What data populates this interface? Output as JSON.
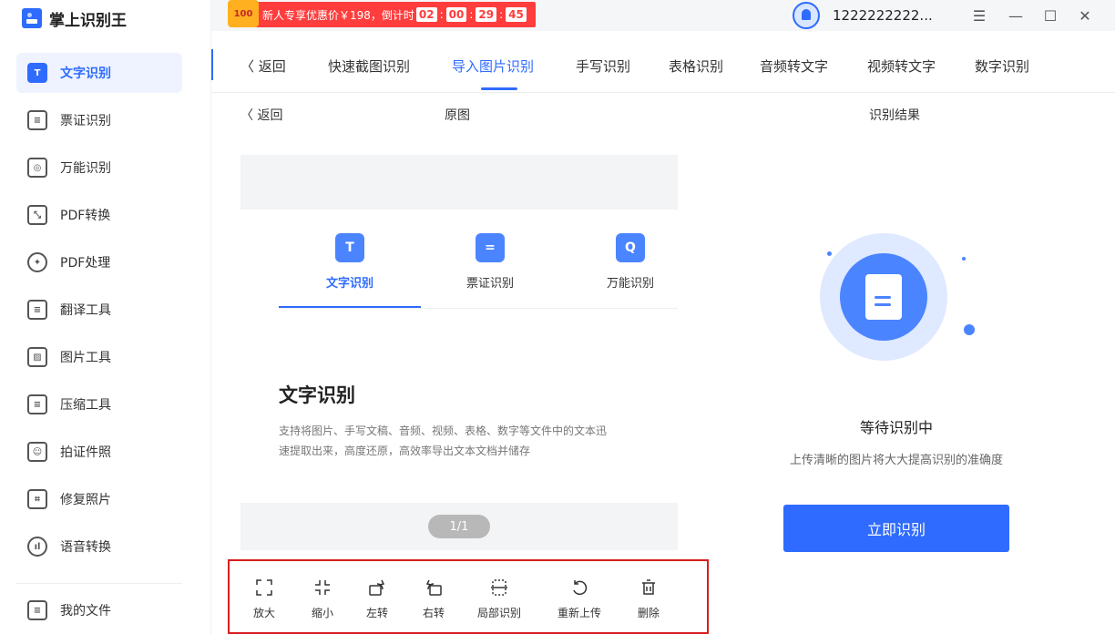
{
  "app": {
    "title": "掌上识别王"
  },
  "promo": {
    "badge": "100",
    "text": "新人专享优惠价￥198，倒计时",
    "h": "02",
    "m": "00",
    "s": "29",
    "ms": "45",
    "sep": ":"
  },
  "user": {
    "name": "1222222222..."
  },
  "window": {
    "menu": "☰",
    "minimize": "—",
    "maximize": "☐",
    "close": "✕"
  },
  "sidebar": {
    "items": [
      {
        "label": "文字识别",
        "icon": "text-recognition-icon",
        "glyph": "T"
      },
      {
        "label": "票证识别",
        "icon": "ticket-icon",
        "glyph": "≡"
      },
      {
        "label": "万能识别",
        "icon": "universal-scan-icon",
        "glyph": "◎"
      },
      {
        "label": "PDF转换",
        "icon": "pdf-convert-icon",
        "glyph": "⤡"
      },
      {
        "label": "PDF处理",
        "icon": "pdf-process-icon",
        "glyph": "✦"
      },
      {
        "label": "翻译工具",
        "icon": "translate-icon",
        "glyph": "≡"
      },
      {
        "label": "图片工具",
        "icon": "image-tool-icon",
        "glyph": "▨"
      },
      {
        "label": "压缩工具",
        "icon": "compress-icon",
        "glyph": "≡"
      },
      {
        "label": "拍证件照",
        "icon": "id-photo-icon",
        "glyph": "☺"
      },
      {
        "label": "修复照片",
        "icon": "repair-photo-icon",
        "glyph": "⌗"
      },
      {
        "label": "语音转换",
        "icon": "voice-convert-icon",
        "glyph": "ıl"
      }
    ],
    "my_files": "我的文件"
  },
  "tabs": {
    "back": "〈 返回",
    "items": [
      "快速截图识别",
      "导入图片识别",
      "手写识别",
      "表格识别",
      "音频转文字",
      "视频转文字",
      "数字识别"
    ]
  },
  "subheader": {
    "back": "〈 返回",
    "original": "原图",
    "result": "识别结果"
  },
  "preview": {
    "mini_tabs": [
      {
        "label": "文字识别",
        "glyph": "T"
      },
      {
        "label": "票证识别",
        "glyph": "="
      },
      {
        "label": "万能识别",
        "glyph": "Q"
      }
    ],
    "feature_title": "文字识别",
    "feature_desc": "支持将图片、手写文稿、音频、视频、表格、数字等文件中的文本迅速提取出来，高度还原，高效率导出文本文档并储存",
    "pager": "1/1"
  },
  "toolbar": {
    "items": [
      {
        "label": "放大",
        "icon": "zoom-in-icon"
      },
      {
        "label": "缩小",
        "icon": "zoom-out-icon"
      },
      {
        "label": "左转",
        "icon": "rotate-left-icon"
      },
      {
        "label": "右转",
        "icon": "rotate-right-icon"
      },
      {
        "label": "局部识别",
        "icon": "crop-recognize-icon"
      },
      {
        "label": "重新上传",
        "icon": "reupload-icon"
      },
      {
        "label": "删除",
        "icon": "trash-icon"
      }
    ]
  },
  "result": {
    "status": "等待识别中",
    "hint": "上传清晰的图片将大大提高识别的准确度",
    "button": "立即识别"
  },
  "colors": {
    "accent": "#2f6bff",
    "promo": "#ff3d3d",
    "highlight_border": "#d81e1e"
  }
}
